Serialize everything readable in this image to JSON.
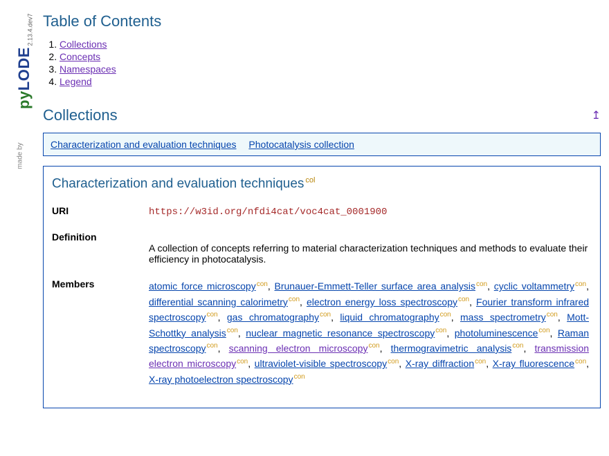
{
  "pylode": {
    "madeby": "made by",
    "logo_p": "p",
    "logo_y": "y",
    "logo_l": "L",
    "logo_o": "O",
    "logo_d": "D",
    "logo_e": "E",
    "version": "2.13.4.dev7"
  },
  "toc": {
    "heading": "Table of Contents",
    "items": [
      "Collections",
      "Concepts",
      "Namespaces",
      "Legend"
    ]
  },
  "collections": {
    "heading": "Collections",
    "back_to_top_glyph": "↥",
    "index": [
      "Characterization and evaluation techniques",
      "Photocatalysis collection"
    ]
  },
  "collection_detail": {
    "title": "Characterization and evaluation techniques",
    "sup_col": "col",
    "labels": {
      "uri": "URI",
      "definition": "Definition",
      "members": "Members"
    },
    "uri": "https://w3id.org/nfdi4cat/voc4cat_0001900",
    "definition": "A collection of concepts referring to material characterization techniques and methods to evaluate their efficiency in photocatalysis.",
    "sup_con": "con",
    "members": [
      {
        "label": "atomic force microscopy",
        "visited": false
      },
      {
        "label": "Brunauer-Emmett-Teller surface area analysis",
        "visited": false
      },
      {
        "label": "cyclic voltammetry",
        "visited": false
      },
      {
        "label": "differential scanning calorimetry",
        "visited": false
      },
      {
        "label": "electron energy loss spectroscopy",
        "visited": false
      },
      {
        "label": "Fourier transform infrared spectroscopy",
        "visited": false
      },
      {
        "label": "gas chromatography",
        "visited": false
      },
      {
        "label": "liquid chromatography",
        "visited": false
      },
      {
        "label": "mass spectrometry",
        "visited": false
      },
      {
        "label": "Mott-Schottky analysis",
        "visited": false
      },
      {
        "label": "nuclear magnetic resonance spectroscopy",
        "visited": false
      },
      {
        "label": "photoluminescence",
        "visited": false
      },
      {
        "label": "Raman spectroscopy",
        "visited": false
      },
      {
        "label": "scanning electron microscopy",
        "visited": true
      },
      {
        "label": "thermogravimetric analysis",
        "visited": false
      },
      {
        "label": "transmission electron microscopy",
        "visited": true
      },
      {
        "label": "ultraviolet-visible spectroscopy",
        "visited": false
      },
      {
        "label": "X-ray diffraction",
        "visited": false
      },
      {
        "label": "X-ray fluorescence",
        "visited": false
      },
      {
        "label": "X-ray photoelectron spectroscopy",
        "visited": false
      }
    ]
  }
}
